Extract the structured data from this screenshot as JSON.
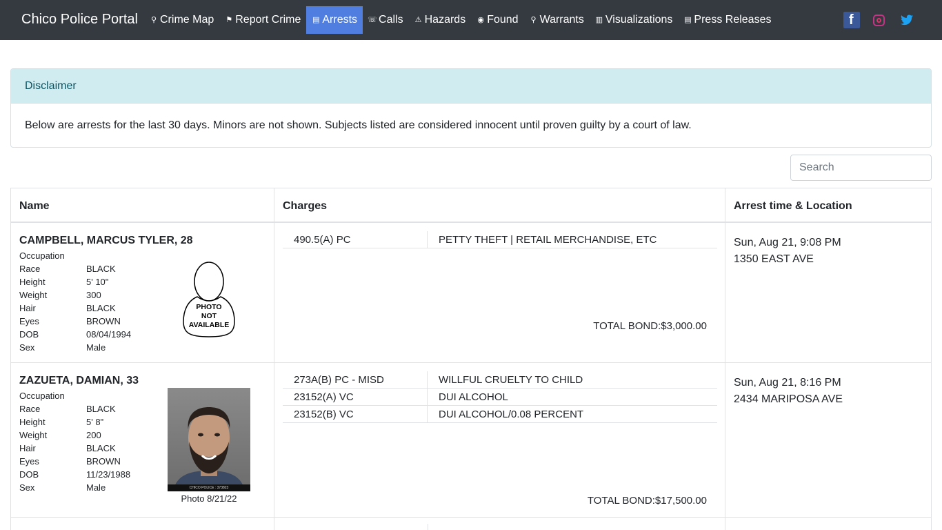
{
  "brand": "Chico Police Portal",
  "nav": [
    {
      "label": "Crime Map",
      "icon": "map-marker-icon",
      "glyph": "⚲"
    },
    {
      "label": "Report Crime",
      "icon": "flag-icon",
      "glyph": "⚑"
    },
    {
      "label": "Arrests",
      "icon": "id-card-icon",
      "glyph": "▤",
      "active": true
    },
    {
      "label": "Calls",
      "icon": "phone-icon",
      "glyph": "☏"
    },
    {
      "label": "Hazards",
      "icon": "warning-icon",
      "glyph": "⚠"
    },
    {
      "label": "Found",
      "icon": "compass-icon",
      "glyph": "◉"
    },
    {
      "label": "Warrants",
      "icon": "search-icon",
      "glyph": "⚲"
    },
    {
      "label": "Visualizations",
      "icon": "chart-icon",
      "glyph": "▥"
    },
    {
      "label": "Press Releases",
      "icon": "newspaper-icon",
      "glyph": "▤"
    }
  ],
  "social": {
    "facebook": "f",
    "colors": {
      "facebook": "#3b5998",
      "instagram": "#e1306c",
      "twitter": "#1da1f2"
    }
  },
  "disclaimer": {
    "title": "Disclaimer",
    "text": "Below are arrests for the last 30 days. Minors are not shown. Subjects listed are considered innocent until proven guilty by a court of law."
  },
  "search": {
    "placeholder": "Search"
  },
  "table": {
    "headers": {
      "name": "Name",
      "charges": "Charges",
      "time": "Arrest time & Location"
    },
    "attr_labels": {
      "occupation": "Occupation",
      "race": "Race",
      "height": "Height",
      "weight": "Weight",
      "hair": "Hair",
      "eyes": "Eyes",
      "dob": "DOB",
      "sex": "Sex"
    },
    "photo_na": [
      "PHOTO",
      "NOT",
      "AVAILABLE"
    ],
    "rows": [
      {
        "name": "CAMPBELL, MARCUS TYLER, 28",
        "race": "BLACK",
        "height": "5' 10\"",
        "weight": "300",
        "hair": "BLACK",
        "eyes": "BROWN",
        "dob": "08/04/1994",
        "sex": "Male",
        "charges": [
          {
            "code": "490.5(A) PC",
            "desc": "PETTY THEFT | RETAIL MERCHANDISE, ETC"
          }
        ],
        "bond": "TOTAL BOND:$3,000.00",
        "time": "Sun, Aug 21, 9:08 PM",
        "location": "1350 EAST AVE"
      },
      {
        "name": "ZAZUETA, DAMIAN, 33",
        "race": "BLACK",
        "height": "5' 8\"",
        "weight": "200",
        "hair": "BLACK",
        "eyes": "BROWN",
        "dob": "11/23/1988",
        "sex": "Male",
        "photo_caption": "Photo 8/21/22",
        "photo_tag": "CHICO POLICE : 373823",
        "charges": [
          {
            "code": "273A(B) PC - MISD",
            "desc": "WILLFUL CRUELTY TO CHILD"
          },
          {
            "code": "23152(A) VC",
            "desc": "DUI ALCOHOL"
          },
          {
            "code": "23152(B) VC",
            "desc": "DUI ALCOHOL/0.08 PERCENT"
          }
        ],
        "bond": "TOTAL BOND:$17,500.00",
        "time": "Sun, Aug 21, 8:16 PM",
        "location": "2434 MARIPOSA AVE"
      }
    ]
  }
}
